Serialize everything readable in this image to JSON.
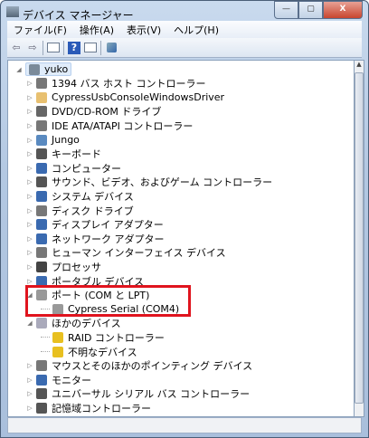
{
  "window": {
    "title": "デバイス マネージャー",
    "min": "—",
    "max": "▢",
    "close": "X"
  },
  "menu": [
    "ファイル(F)",
    "操作(A)",
    "表示(V)",
    "ヘルプ(H)"
  ],
  "toolbar": {
    "back": "⇦",
    "forward": "⇨",
    "help": "?"
  },
  "tree": {
    "root": "yuko",
    "items": [
      {
        "label": "1394 バス ホスト コントローラー",
        "color": "#777",
        "expanded": false,
        "level": 1
      },
      {
        "label": "CypressUsbConsoleWindowsDriver",
        "color": "#e8c070",
        "expanded": false,
        "level": 1
      },
      {
        "label": "DVD/CD-ROM ドライブ",
        "color": "#666",
        "expanded": false,
        "level": 1
      },
      {
        "label": "IDE ATA/ATAPI コントローラー",
        "color": "#777",
        "expanded": false,
        "level": 1
      },
      {
        "label": "Jungo",
        "color": "#5a8ac0",
        "expanded": false,
        "level": 1
      },
      {
        "label": "キーボード",
        "color": "#555",
        "expanded": false,
        "level": 1
      },
      {
        "label": "コンピューター",
        "color": "#3a6ab0",
        "expanded": false,
        "level": 1
      },
      {
        "label": "サウンド、ビデオ、およびゲーム コントローラー",
        "color": "#555",
        "expanded": false,
        "level": 1
      },
      {
        "label": "システム デバイス",
        "color": "#3a6ab0",
        "expanded": false,
        "level": 1
      },
      {
        "label": "ディスク ドライブ",
        "color": "#777",
        "expanded": false,
        "level": 1
      },
      {
        "label": "ディスプレイ アダプター",
        "color": "#3a6ab0",
        "expanded": false,
        "level": 1
      },
      {
        "label": "ネットワーク アダプター",
        "color": "#3a6ab0",
        "expanded": false,
        "level": 1
      },
      {
        "label": "ヒューマン インターフェイス デバイス",
        "color": "#777",
        "expanded": false,
        "level": 1
      },
      {
        "label": "プロセッサ",
        "color": "#444",
        "expanded": false,
        "level": 1
      },
      {
        "label": "ポータブル デバイス",
        "color": "#3a6ab0",
        "expanded": false,
        "level": 1
      },
      {
        "label": "ポート (COM と LPT)",
        "color": "#999",
        "expanded": true,
        "level": 1
      },
      {
        "label": "Cypress Serial (COM4)",
        "color": "#999",
        "level": 2
      },
      {
        "label": "ほかのデバイス",
        "color": "#aab",
        "expanded": true,
        "level": 1
      },
      {
        "label": "RAID コントローラー",
        "color": "#e8c020",
        "level": 2
      },
      {
        "label": "不明なデバイス",
        "color": "#e8c020",
        "level": 2
      },
      {
        "label": "マウスとそのほかのポインティング デバイス",
        "color": "#777",
        "expanded": false,
        "level": 1
      },
      {
        "label": "モニター",
        "color": "#3a6ab0",
        "expanded": false,
        "level": 1
      },
      {
        "label": "ユニバーサル シリアル バス コントローラー",
        "color": "#555",
        "expanded": false,
        "level": 1
      },
      {
        "label": "記憶域コントローラー",
        "color": "#555",
        "expanded": false,
        "level": 1
      }
    ]
  },
  "highlight_color": "#e0141e"
}
